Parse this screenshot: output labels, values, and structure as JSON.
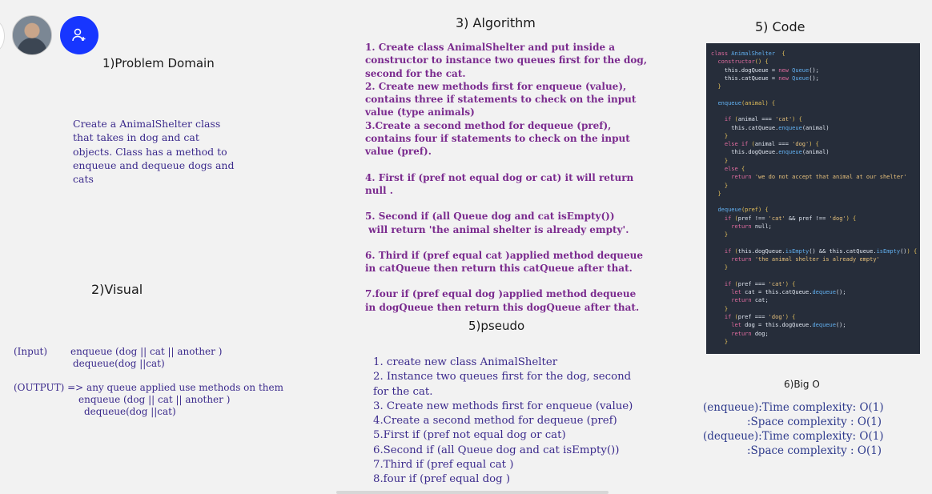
{
  "headings": {
    "problem_domain": "1)Problem Domain",
    "visual": "2)Visual",
    "algorithm": "3) Algorithm",
    "pseudo": "5)pseudo",
    "code": "5) Code",
    "big_o": "6)Big O"
  },
  "problem_text": "Create a AnimalShelter class that takes in dog and cat objects. Class has a method to enqueue and dequeue dogs and cats",
  "visual": {
    "input_label": "(Input)",
    "input_line1": "enqueue (dog || cat || another )",
    "input_line2": "dequeue(dog ||cat)",
    "output_line": "(OUTPUT) => any queue applied use methods on them",
    "output_line2": "enqueue (dog || cat || another )",
    "output_line3": "dequeue(dog ||cat)"
  },
  "algorithm": [
    "1. Create class AnimalShelter and put inside a constructor to instance two queues first for the dog, second for the cat.",
    "2. Create new methods first for enqueue (value), contains three if statements to check on the input value (type animals)",
    "3.Create a second method for dequeue (pref), contains four if statements to check on the input value (pref).",
    "4. First if (pref not equal dog or cat) it will return null .",
    "5. Second if (all Queue dog and cat isEmpty())",
    " will return 'the animal shelter is already empty'.",
    "6. Third if (pref equal cat )applied method dequeue in catQueue then return this catQueue after that.",
    "7.four if (pref equal dog )applied method dequeue in dogQueue then return this dogQueue after that."
  ],
  "pseudo": [
    "1. create new class AnimalShelter",
    "2. Instance two queues first for the dog, second for the cat.",
    "3. Create new methods first for enqueue (value)",
    "4.Create a second method for dequeue (pref)",
    "5.First if (pref not equal dog or cat)",
    "6.Second if (all Queue dog and cat isEmpty())",
    "7.Third if (pref equal cat )",
    "8.four if (pref equal dog )"
  ],
  "big_o": {
    "line1": "(enqueue):Time complexity: O(1)",
    "line2": ":Space complexity : O(1)",
    "line3": "(dequeue):Time complexity: O(1)",
    "line4": ":Space complexity : O(1)"
  },
  "code_lines": [
    [
      [
        "k",
        "class "
      ],
      [
        "f",
        "AnimalShelter"
      ],
      [
        "",
        "  "
      ],
      [
        "b",
        "{"
      ]
    ],
    [
      [
        "",
        "  "
      ],
      [
        "k",
        "constructor"
      ],
      [
        "b",
        "() {"
      ]
    ],
    [
      [
        "",
        "    this.dogQueue = "
      ],
      [
        "k",
        "new "
      ],
      [
        "f",
        "Queue"
      ],
      [
        "",
        "();"
      ]
    ],
    [
      [
        "",
        "    this.catQueue = "
      ],
      [
        "k",
        "new "
      ],
      [
        "f",
        "Queue"
      ],
      [
        "",
        "();"
      ]
    ],
    [
      [
        "",
        "  "
      ],
      [
        "b",
        "}"
      ]
    ],
    [
      [
        "",
        ""
      ]
    ],
    [
      [
        "",
        "  "
      ],
      [
        "f",
        "enqueue"
      ],
      [
        "b",
        "(animal) {"
      ]
    ],
    [
      [
        "",
        ""
      ]
    ],
    [
      [
        "",
        "    "
      ],
      [
        "k",
        "if "
      ],
      [
        "b",
        "("
      ],
      [
        "",
        "animal === "
      ],
      [
        "s",
        "'cat'"
      ],
      [
        "b",
        ") {"
      ]
    ],
    [
      [
        "",
        "      this.catQueue."
      ],
      [
        "f",
        "enqueue"
      ],
      [
        "",
        "(animal)"
      ]
    ],
    [
      [
        "",
        "    "
      ],
      [
        "b",
        "}"
      ]
    ],
    [
      [
        "",
        "    "
      ],
      [
        "k",
        "else if "
      ],
      [
        "b",
        "("
      ],
      [
        "",
        "animal === "
      ],
      [
        "s",
        "'dog'"
      ],
      [
        "b",
        ") {"
      ]
    ],
    [
      [
        "",
        "      this.dogQueue."
      ],
      [
        "f",
        "enqueue"
      ],
      [
        "",
        "(animal)"
      ]
    ],
    [
      [
        "",
        "    "
      ],
      [
        "b",
        "}"
      ]
    ],
    [
      [
        "",
        "    "
      ],
      [
        "k",
        "else "
      ],
      [
        "b",
        "{"
      ]
    ],
    [
      [
        "",
        "      "
      ],
      [
        "k",
        "return "
      ],
      [
        "s",
        "'we do not accept that animal at our shelter'"
      ]
    ],
    [
      [
        "",
        "    "
      ],
      [
        "b",
        "}"
      ]
    ],
    [
      [
        "",
        "  "
      ],
      [
        "b",
        "}"
      ]
    ],
    [
      [
        "",
        ""
      ]
    ],
    [
      [
        "",
        "  "
      ],
      [
        "f",
        "dequeue"
      ],
      [
        "b",
        "(pref) {"
      ]
    ],
    [
      [
        "",
        "    "
      ],
      [
        "k",
        "if "
      ],
      [
        "b",
        "("
      ],
      [
        "",
        "pref !== "
      ],
      [
        "s",
        "'cat'"
      ],
      [
        "",
        " && pref !== "
      ],
      [
        "s",
        "'dog'"
      ],
      [
        "b",
        ") {"
      ]
    ],
    [
      [
        "",
        "      "
      ],
      [
        "k",
        "return "
      ],
      [
        "",
        "null;"
      ]
    ],
    [
      [
        "",
        "    "
      ],
      [
        "b",
        "}"
      ]
    ],
    [
      [
        "",
        ""
      ]
    ],
    [
      [
        "",
        "    "
      ],
      [
        "k",
        "if "
      ],
      [
        "b",
        "("
      ],
      [
        "",
        "this.dogQueue."
      ],
      [
        "f",
        "isEmpty"
      ],
      [
        "",
        "() && this.catQueue."
      ],
      [
        "f",
        "isEmpty"
      ],
      [
        "",
        "()"
      ],
      [
        "b",
        ") {"
      ]
    ],
    [
      [
        "",
        "      "
      ],
      [
        "k",
        "return "
      ],
      [
        "s",
        "'the animal shelter is already empty'"
      ]
    ],
    [
      [
        "",
        "    "
      ],
      [
        "b",
        "}"
      ]
    ],
    [
      [
        "",
        ""
      ]
    ],
    [
      [
        "",
        "    "
      ],
      [
        "k",
        "if "
      ],
      [
        "b",
        "("
      ],
      [
        "",
        "pref === "
      ],
      [
        "s",
        "'cat'"
      ],
      [
        "b",
        ") {"
      ]
    ],
    [
      [
        "",
        "      "
      ],
      [
        "k",
        "let "
      ],
      [
        "",
        "cat = this.catQueue."
      ],
      [
        "f",
        "dequeue"
      ],
      [
        "",
        "();"
      ]
    ],
    [
      [
        "",
        "      "
      ],
      [
        "k",
        "return "
      ],
      [
        "",
        "cat;"
      ]
    ],
    [
      [
        "",
        "    "
      ],
      [
        "b",
        "}"
      ]
    ],
    [
      [
        "",
        "    "
      ],
      [
        "k",
        "if "
      ],
      [
        "b",
        "("
      ],
      [
        "",
        "pref === "
      ],
      [
        "s",
        "'dog'"
      ],
      [
        "b",
        ") {"
      ]
    ],
    [
      [
        "",
        "      "
      ],
      [
        "k",
        "let "
      ],
      [
        "",
        "dog = this.dogQueue."
      ],
      [
        "f",
        "dequeue"
      ],
      [
        "",
        "();"
      ]
    ],
    [
      [
        "",
        "      "
      ],
      [
        "k",
        "return "
      ],
      [
        "",
        "dog;"
      ]
    ],
    [
      [
        "",
        "    "
      ],
      [
        "b",
        "}"
      ]
    ]
  ]
}
